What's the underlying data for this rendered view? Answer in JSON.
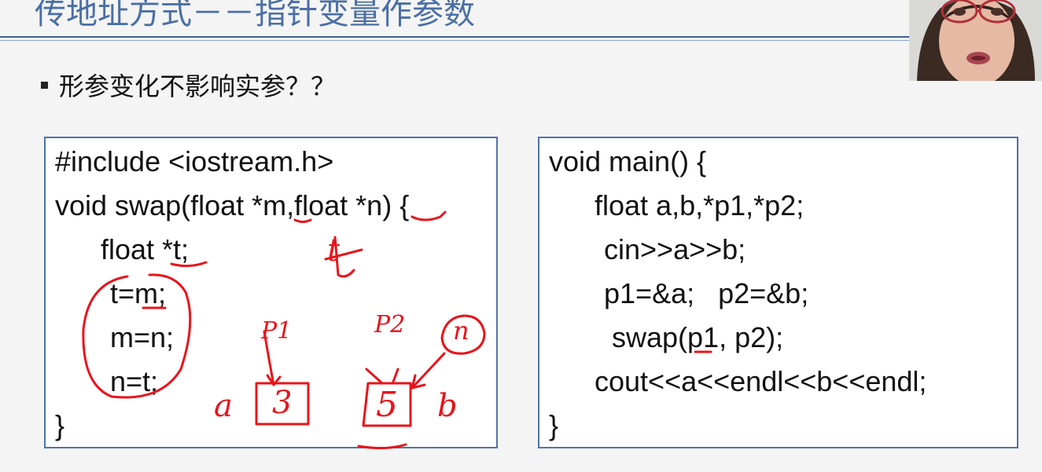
{
  "title": "传地址方式－－指针变量作参数",
  "bullet": "形参变化不影响实参？？",
  "left_code": [
    "#include <iostream.h>",
    "void swap(float *m,float *n) {",
    "float *t;",
    "t=m;",
    "m=n;",
    "n=t;",
    "}"
  ],
  "right_code": [
    "void main() {",
    "float a,b,*p1,*p2;",
    "cin>>a>>b;",
    "p1=&a;   p2=&b;",
    "swap(p1, p2);",
    "cout<<a<<endl<<b<<endl;",
    "}"
  ],
  "annotations": {
    "var_a": "a",
    "var_b": "b",
    "val_a": "3",
    "val_b": "5",
    "ptr_1": "P1",
    "ptr_2": "P2",
    "ptr_n": "n",
    "ptr_t": "t"
  },
  "colors": {
    "title": "#4a6fa5",
    "box_border": "#4d73ac",
    "ink": "#e8141c"
  }
}
